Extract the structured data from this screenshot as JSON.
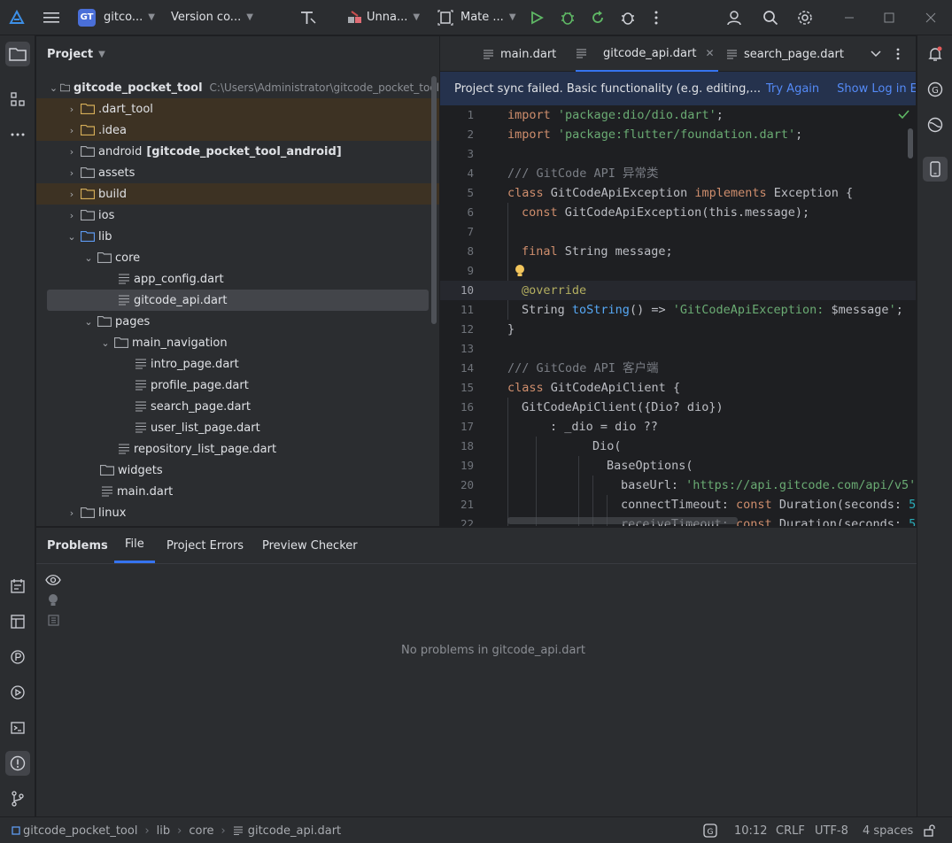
{
  "titlebar": {
    "project_badge": "GT",
    "project_name": "gitco...",
    "vcs": "Version co...",
    "run_config": "Unna...",
    "device": "Mate ..."
  },
  "project_panel": {
    "title": "Project",
    "root_name": "gitcode_pocket_tool",
    "root_path": "C:\\Users\\Administrator\\gitcode_pocket_tool",
    "items": [
      {
        "label": ".dart_tool"
      },
      {
        "label": ".idea"
      },
      {
        "label": "android",
        "suffix": "[gitcode_pocket_tool_android]"
      },
      {
        "label": "assets"
      },
      {
        "label": "build"
      },
      {
        "label": "ios"
      },
      {
        "label": "lib"
      },
      {
        "label": "core"
      },
      {
        "label": "app_config.dart"
      },
      {
        "label": "gitcode_api.dart"
      },
      {
        "label": "pages"
      },
      {
        "label": "main_navigation"
      },
      {
        "label": "intro_page.dart"
      },
      {
        "label": "profile_page.dart"
      },
      {
        "label": "search_page.dart"
      },
      {
        "label": "user_list_page.dart"
      },
      {
        "label": "repository_list_page.dart"
      },
      {
        "label": "widgets"
      },
      {
        "label": "main.dart"
      },
      {
        "label": "linux"
      }
    ]
  },
  "editor": {
    "tabs": [
      "main.dart",
      "gitcode_api.dart",
      "search_page.dart"
    ],
    "banner": {
      "message": "Project sync failed. Basic functionality (e.g. editing,...",
      "try_again": "Try Again",
      "show_log": "Show Log in Explorer"
    },
    "line_numbers": [
      "1",
      "2",
      "3",
      "4",
      "5",
      "6",
      "7",
      "8",
      "9",
      "10",
      "11",
      "12",
      "13",
      "14",
      "15",
      "16",
      "17",
      "18",
      "19",
      "20",
      "21",
      "22"
    ],
    "code": {
      "l1_kw": "import",
      "l1_str": "'package:dio/dio.dart'",
      "l1_end": ";",
      "l2_kw": "import",
      "l2_str": "'package:flutter/foundation.dart'",
      "l2_end": ";",
      "l4_cm": "/// GitCode API 异常类",
      "l5_kw1": "class",
      "l5_name": " GitCodeApiException ",
      "l5_kw2": "implements",
      "l5_rest": " Exception {",
      "l6_kw": "const",
      "l6_rest": " GitCodeApiException(this.message);",
      "l8_kw": "final",
      "l8_rest": " String message;",
      "l10_ann": "@override",
      "l11_a": "String ",
      "l11_fn": "toString",
      "l11_b": "() => ",
      "l11_str": "'GitCodeApiException: ",
      "l11_var": "$message",
      "l11_str2": "'",
      "l11_end": ";",
      "l12": "}",
      "l14_cm": "/// GitCode API 客户端",
      "l15_kw": "class",
      "l15_rest": " GitCodeApiClient {",
      "l16": "GitCodeApiClient({Dio? dio})",
      "l17": ": _dio = dio ??",
      "l18": "Dio(",
      "l19": "BaseOptions(",
      "l20_a": "baseUrl: ",
      "l20_str": "'https://api.gitcode.com/api/v5'",
      "l20_end": ",",
      "l21_a": "connectTimeout: ",
      "l21_kw": "const",
      "l21_b": " Duration(seconds: ",
      "l21_num": "5",
      "l21_end": ")",
      "l22_a": "receiveTimeout: ",
      "l22_kw": "const",
      "l22_b": " Duration(seconds: ",
      "l22_num": "5",
      "l22_end": ")"
    }
  },
  "problems": {
    "title": "Problems",
    "tabs": [
      "File",
      "Project Errors",
      "Preview Checker"
    ],
    "empty_message": "No problems in gitcode_api.dart"
  },
  "statusbar": {
    "breadcrumb": [
      "gitcode_pocket_tool",
      "lib",
      "core",
      "gitcode_api.dart"
    ],
    "position": "10:12",
    "line_ending": "CRLF",
    "encoding": "UTF-8",
    "indent": "4 spaces"
  }
}
